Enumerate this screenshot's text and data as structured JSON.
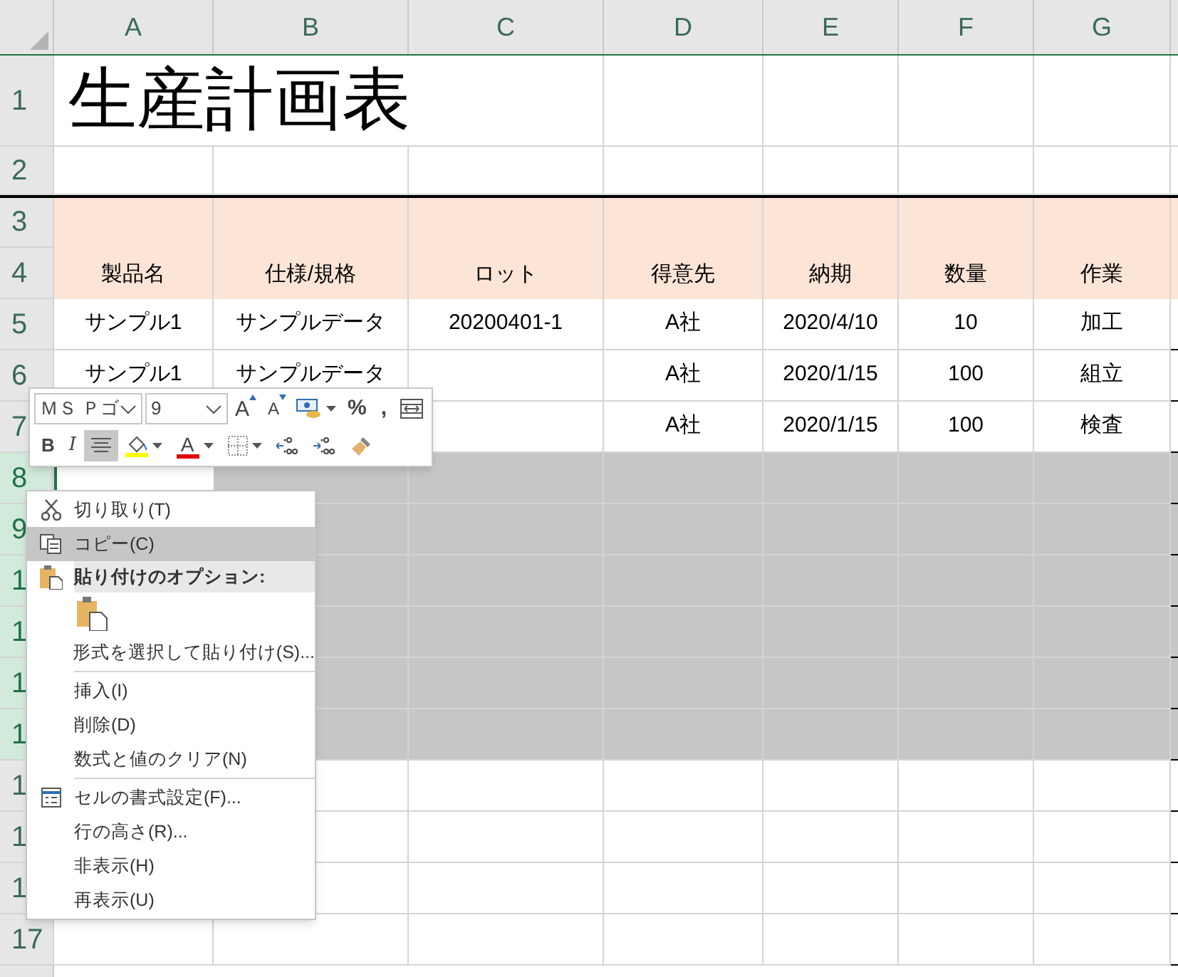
{
  "columns": [
    "A",
    "B",
    "C",
    "D",
    "E",
    "F",
    "G"
  ],
  "rows": [
    {
      "header": "1",
      "kind": "title",
      "selected": false,
      "cells": [
        "生産計画表"
      ]
    },
    {
      "header": "2",
      "kind": "plain",
      "selected": false,
      "cells": []
    },
    {
      "header": "3",
      "kind": "band_top",
      "selected": false,
      "cells": []
    },
    {
      "header": "4",
      "kind": "band",
      "selected": false,
      "cells": [
        "製品名",
        "仕様/規格",
        "ロット",
        "得意先",
        "納期",
        "数量",
        "作業"
      ]
    },
    {
      "header": "5",
      "kind": "data",
      "selected": false,
      "cells": [
        "サンプル1",
        "サンプルデータ",
        "20200401-1",
        "A社",
        "2020/4/10",
        "10",
        "加工"
      ]
    },
    {
      "header": "6",
      "kind": "data",
      "selected": false,
      "cells": [
        "サンプル1",
        "サンプルデータ",
        null,
        "A社",
        "2020/1/15",
        "100",
        "組立"
      ]
    },
    {
      "header": "7",
      "kind": "data",
      "selected": false,
      "cells": [
        null,
        null,
        null,
        "A社",
        "2020/1/15",
        "100",
        "検査"
      ]
    },
    {
      "header": "8",
      "kind": "data",
      "selected": true,
      "active_cell": true,
      "cells": []
    },
    {
      "header": "9",
      "kind": "data",
      "selected": true,
      "cells": []
    },
    {
      "header": "1",
      "kind": "data",
      "selected": true,
      "cells": []
    },
    {
      "header": "1",
      "kind": "data",
      "selected": true,
      "cells": []
    },
    {
      "header": "1",
      "kind": "data",
      "selected": true,
      "cells": []
    },
    {
      "header": "1",
      "kind": "data",
      "selected": true,
      "cells": []
    },
    {
      "header": "1",
      "kind": "data",
      "selected": false,
      "cells": []
    },
    {
      "header": "1",
      "kind": "data",
      "selected": false,
      "cells": []
    },
    {
      "header": "1",
      "kind": "data",
      "selected": false,
      "cells": []
    },
    {
      "header": "17",
      "kind": "data",
      "selected": false,
      "cells": []
    }
  ],
  "mini_toolbar": {
    "font": "ＭＳ Ｐゴ",
    "size": "9",
    "top_tools": [
      {
        "kind": "grow_font",
        "label": "A"
      },
      {
        "kind": "shrink_font",
        "label": "A"
      },
      {
        "kind": "accounting"
      },
      {
        "kind": "text",
        "label": "%"
      },
      {
        "kind": "text",
        "label": ","
      },
      {
        "kind": "wrap"
      }
    ],
    "bottom_tools": [
      {
        "kind": "bold",
        "label": "B",
        "selected": false
      },
      {
        "kind": "italic",
        "label": "I",
        "selected": false
      },
      {
        "kind": "center",
        "selected": true
      },
      {
        "kind": "fill_color",
        "selected": false
      },
      {
        "kind": "font_color",
        "label": "A",
        "selected": false
      },
      {
        "kind": "borders",
        "selected": false
      },
      {
        "kind": "increase_decimal",
        "selected": false
      },
      {
        "kind": "decrease_decimal",
        "selected": false
      },
      {
        "kind": "painter",
        "selected": false
      }
    ]
  },
  "context_menu": [
    {
      "kind": "cut",
      "label": "切り取り(T)",
      "selected": false
    },
    {
      "kind": "copy",
      "label": "コピー(C)",
      "selected": true
    },
    {
      "kind": "section",
      "label": "貼り付けのオプション:"
    },
    {
      "kind": "paste_option"
    },
    {
      "kind": "item",
      "label": "形式を選択して貼り付け(S)...",
      "selected": false
    },
    {
      "kind": "separator"
    },
    {
      "kind": "item",
      "label": "挿入(I)",
      "selected": false
    },
    {
      "kind": "item",
      "label": "削除(D)",
      "selected": false
    },
    {
      "kind": "item",
      "label": "数式と値のクリア(N)",
      "selected": false
    },
    {
      "kind": "separator"
    },
    {
      "kind": "format_cells",
      "label": "セルの書式設定(F)...",
      "selected": false
    },
    {
      "kind": "item",
      "label": "行の高さ(R)...",
      "selected": false
    },
    {
      "kind": "item",
      "label": "非表示(H)",
      "selected": false
    },
    {
      "kind": "item",
      "label": "再表示(U)",
      "selected": false
    }
  ]
}
